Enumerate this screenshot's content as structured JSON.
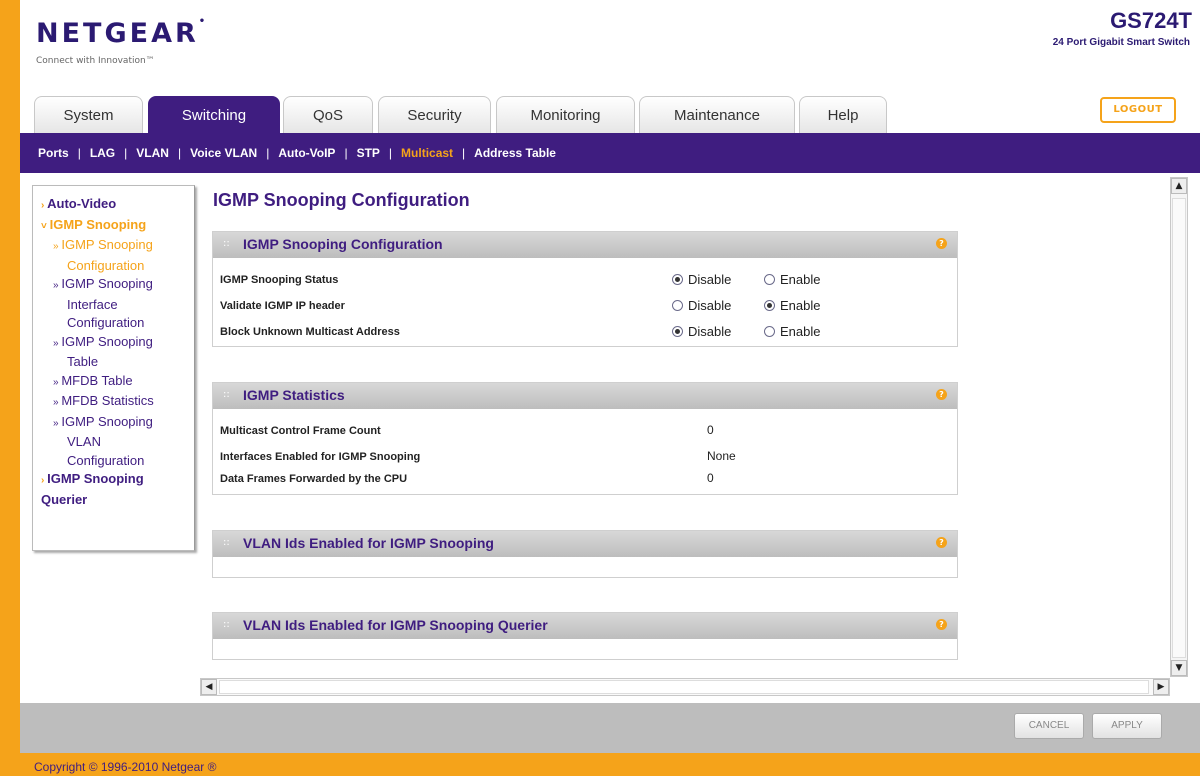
{
  "brand": {
    "logo": "NETGEAR",
    "tagline": "Connect with Innovation™"
  },
  "device": {
    "model": "GS724T",
    "description": "24 Port Gigabit Smart Switch"
  },
  "tabs": [
    {
      "label": "System"
    },
    {
      "label": "Switching",
      "active": true
    },
    {
      "label": "QoS"
    },
    {
      "label": "Security"
    },
    {
      "label": "Monitoring"
    },
    {
      "label": "Maintenance"
    },
    {
      "label": "Help"
    }
  ],
  "logout_label": "LOGOUT",
  "subnav": [
    {
      "label": "Ports"
    },
    {
      "label": "LAG"
    },
    {
      "label": "VLAN"
    },
    {
      "label": "Voice VLAN"
    },
    {
      "label": "Auto-VoIP"
    },
    {
      "label": "STP"
    },
    {
      "label": "Multicast",
      "active": true
    },
    {
      "label": "Address Table"
    }
  ],
  "sidebar": {
    "auto_video": "Auto-Video",
    "igmp_snooping": "IGMP Snooping",
    "igmp_config_1": "IGMP Snooping",
    "igmp_config_2": "Configuration",
    "iface_config_1": "IGMP Snooping",
    "iface_config_2": "Interface",
    "iface_config_3": "Configuration",
    "table_1": "IGMP Snooping",
    "table_2": "Table",
    "mfdb_table": "MFDB Table",
    "mfdb_stats": "MFDB Statistics",
    "vlan_config_1": "IGMP Snooping",
    "vlan_config_2": "VLAN",
    "vlan_config_3": "Configuration",
    "querier_1": "IGMP Snooping",
    "querier_2": "Querier"
  },
  "page_title": "IGMP Snooping Configuration",
  "config_panel": {
    "title": "IGMP Snooping Configuration",
    "rows": [
      {
        "label": "IGMP Snooping Status",
        "options": [
          "Disable",
          "Enable"
        ],
        "selected": "Disable"
      },
      {
        "label": "Validate IGMP IP header",
        "options": [
          "Disable",
          "Enable"
        ],
        "selected": "Enable"
      },
      {
        "label": "Block Unknown Multicast Address",
        "options": [
          "Disable",
          "Enable"
        ],
        "selected": "Disable"
      }
    ]
  },
  "stats_panel": {
    "title": "IGMP Statistics",
    "rows": [
      {
        "label": "Multicast Control Frame Count",
        "value": "0"
      },
      {
        "label": "Interfaces Enabled for IGMP Snooping",
        "value": "None"
      },
      {
        "label": "Data Frames Forwarded by the CPU",
        "value": "0"
      }
    ]
  },
  "vlan_panel": {
    "title": "VLAN Ids Enabled for IGMP Snooping"
  },
  "querier_panel": {
    "title": "VLAN Ids Enabled for IGMP Snooping Querier"
  },
  "buttons": {
    "cancel": "CANCEL",
    "apply": "APPLY"
  },
  "copyright": "Copyright © 1996-2010 Netgear ®",
  "colors": {
    "brand_purple": "#3f1d80",
    "accent_orange": "#f5a31a",
    "panel_header_gray": "#c8c8c8"
  }
}
